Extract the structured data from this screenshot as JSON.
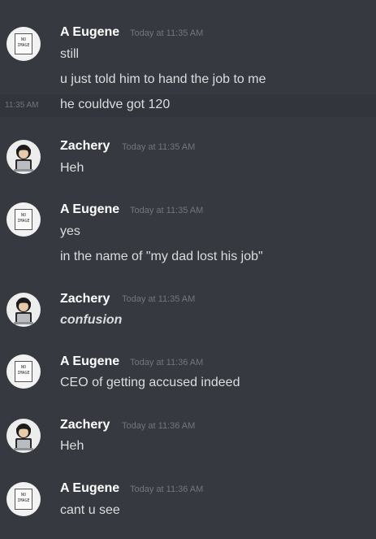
{
  "messages": [
    {
      "author": "A Eugene",
      "time": "Today at 11:35 AM",
      "lines": [
        "still",
        "u just told him to hand the job to me"
      ],
      "hover_line": "he couldve got 120",
      "hover_time": "11:35 AM"
    },
    {
      "author": "Zachery",
      "time": "Today at 11:35 AM",
      "lines": [
        "Heh"
      ]
    },
    {
      "author": "A Eugene",
      "time": "Today at 11:35 AM",
      "lines": [
        "yes",
        "in the name of \"my dad lost his job\""
      ]
    },
    {
      "author": "Zachery",
      "time": "Today at 11:35 AM",
      "lines": [
        "confusion"
      ]
    },
    {
      "author": "A Eugene",
      "time": "Today at 11:36 AM",
      "lines": [
        "CEO of getting accused indeed"
      ]
    },
    {
      "author": "Zachery",
      "time": "Today at 11:36 AM",
      "lines": [
        "Heh"
      ]
    },
    {
      "author": "A Eugene",
      "time": "Today at 11:36 AM",
      "lines": [
        "cant u see"
      ]
    }
  ],
  "avatars": {
    "no_image_text_1": "NO",
    "no_image_text_2": "IMAGE"
  },
  "colors": {
    "background": "#36393f",
    "hover_background": "#32353b",
    "author": "#ffffff",
    "text": "#dcddde",
    "timestamp": "#72767d"
  },
  "icons": {
    "no_image_avatar": "no-image-avatar-icon",
    "zachery_avatar": "person-with-laptop-icon"
  }
}
